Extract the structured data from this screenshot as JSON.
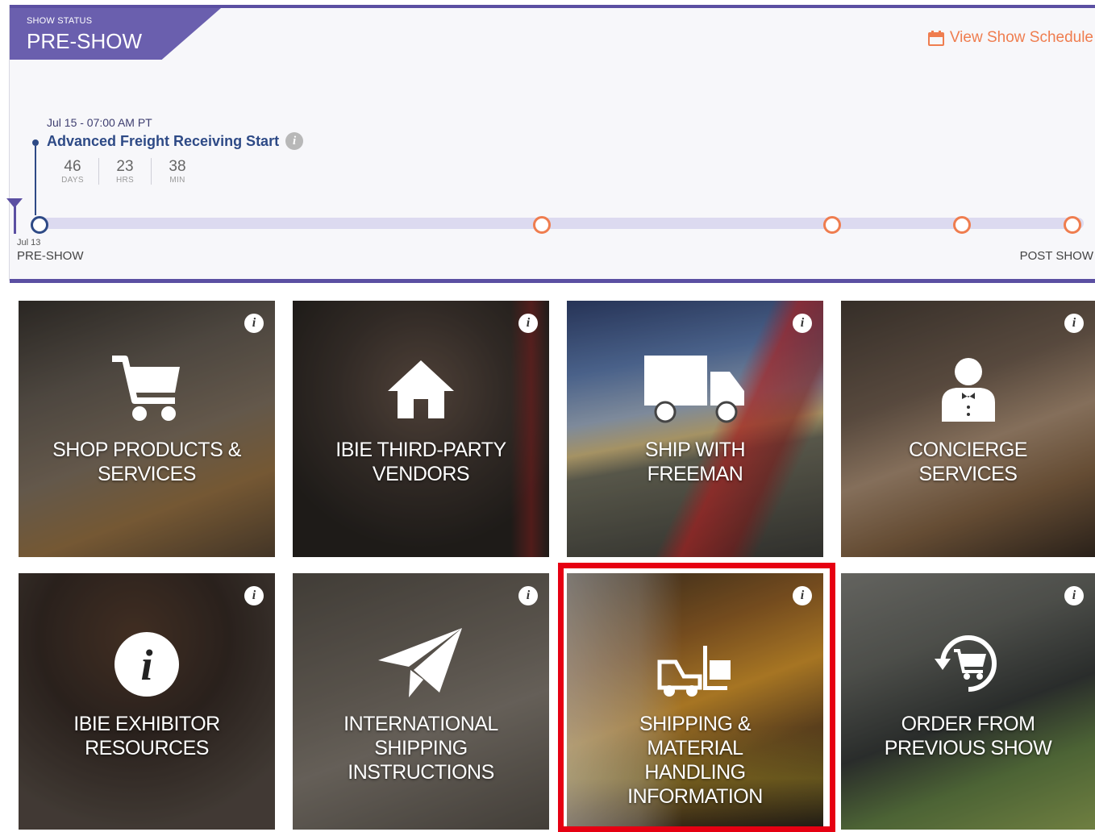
{
  "status": {
    "label": "SHOW STATUS",
    "value": "PRE-SHOW"
  },
  "header": {
    "schedule_link": "View Show Schedule",
    "schedule_icon": "calendar-icon"
  },
  "event": {
    "date": "Jul 15 - 07:00 AM PT",
    "title": "Advanced Freight Receiving Start",
    "countdown": [
      {
        "value": "46",
        "unit": "DAYS"
      },
      {
        "value": "23",
        "unit": "HRS"
      },
      {
        "value": "38",
        "unit": "MIN"
      }
    ]
  },
  "timeline": {
    "start_date": "Jul 13",
    "start_label": "PRE-SHOW",
    "end_label": "POST SHOW"
  },
  "tiles": [
    {
      "line1": "SHOP PRODUCTS &",
      "line2": "SERVICES",
      "icon": "shopping-cart-icon"
    },
    {
      "line1": "IBIE THIRD-PARTY",
      "line2": "VENDORS",
      "icon": "house-icon"
    },
    {
      "line1": "SHIP WITH",
      "line2": "FREEMAN",
      "icon": "truck-icon"
    },
    {
      "line1": "CONCIERGE",
      "line2": "SERVICES",
      "icon": "concierge-icon"
    },
    {
      "line1": "IBIE EXHIBITOR",
      "line2": "RESOURCES",
      "icon": "info-circle-icon"
    },
    {
      "line1": "INTERNATIONAL",
      "line2": "SHIPPING",
      "line3": "INSTRUCTIONS",
      "icon": "paper-plane-icon"
    },
    {
      "line1": "SHIPPING &",
      "line2": "MATERIAL",
      "line3": "HANDLING",
      "line4": "INFORMATION",
      "icon": "forklift-icon"
    },
    {
      "line1": "ORDER FROM",
      "line2": "PREVIOUS SHOW",
      "icon": "reorder-cart-icon"
    }
  ],
  "info_glyph": "i",
  "colors": {
    "accent": "#5b4fa2",
    "orange": "#ef7d4f",
    "navy": "#2e4a86",
    "highlight": "#e60012"
  }
}
